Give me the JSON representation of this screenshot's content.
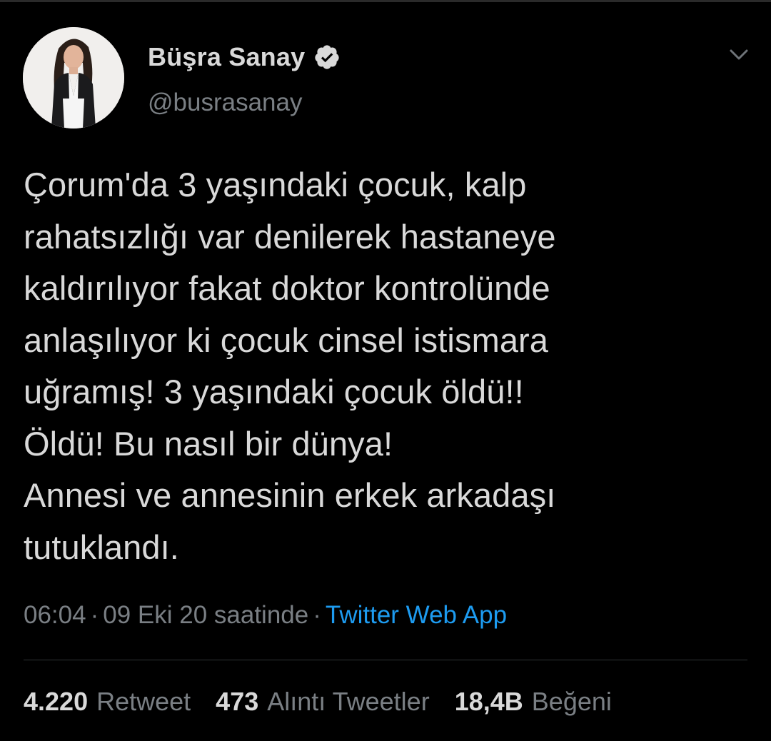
{
  "user": {
    "display_name": "Büşra Sanay",
    "handle": "@busrasanay"
  },
  "icons": {
    "verified": "verified-badge-icon",
    "more": "chevron-down-icon"
  },
  "tweet": {
    "text": "Çorum'da 3 yaşındaki çocuk, kalp\nrahatsızlığı var denilerek hastaneye\nkaldırılıyor fakat doktor kontrolünde\nanlaşılıyor ki çocuk cinsel istismara\nuğramış! 3 yaşındaki çocuk öldü!!\nÖldü! Bu nasıl bir dünya!\nAnnesi ve annesinin erkek arkadaşı\ntutuklandı.",
    "time": "06:04",
    "separator": "·",
    "date": "09 Eki 20 saatinde",
    "source": "Twitter Web App"
  },
  "stats": {
    "retweets": {
      "count": "4.220",
      "label": "Retweet"
    },
    "quotes": {
      "count": "473",
      "label": "Alıntı Tweetler"
    },
    "likes": {
      "count": "18,4B",
      "label": "Beğeni"
    }
  },
  "colors": {
    "background": "#000000",
    "primary_text": "#d9d9d9",
    "secondary_text": "#7a7f84",
    "link": "#1d9bf0",
    "divider": "#2f3336"
  }
}
